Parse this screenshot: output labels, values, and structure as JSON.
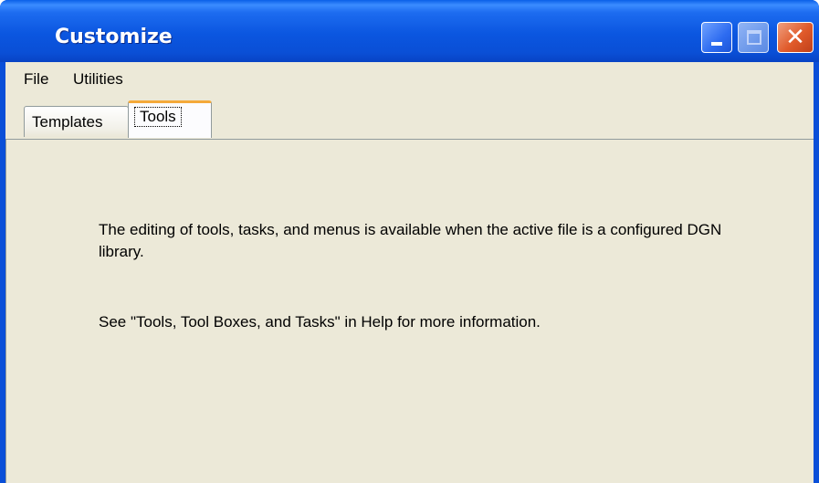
{
  "window": {
    "title": "Customize",
    "titlebar_color": "#0a4fd8",
    "close_color": "#e05a2a",
    "client_bg": "#ece9d8"
  },
  "titlebar_buttons": {
    "minimize": "minimize-icon",
    "maximize": "maximize-icon",
    "close": "close-icon",
    "close_glyph": "✕"
  },
  "menu": {
    "items": [
      {
        "label": "File"
      },
      {
        "label": "Utilities"
      }
    ]
  },
  "tabs": [
    {
      "label": "Templates",
      "active": false
    },
    {
      "label": "Tools",
      "active": true
    }
  ],
  "panel": {
    "message_1": "The editing of tools, tasks, and menus is available when the active file is a configured DGN library.",
    "message_2": "See \"Tools, Tool Boxes, and Tasks\" in Help for more information."
  }
}
